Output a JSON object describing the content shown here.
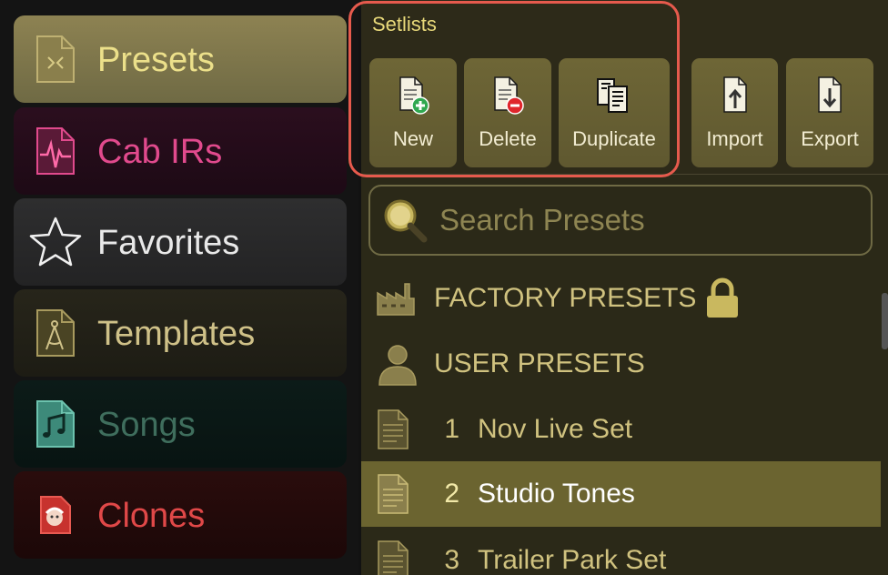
{
  "sidebar": {
    "items": [
      {
        "label": "Presets",
        "icon": "presets-file-icon"
      },
      {
        "label": "Cab IRs",
        "icon": "cab-ir-waveform-icon"
      },
      {
        "label": "Favorites",
        "icon": "star-icon"
      },
      {
        "label": "Templates",
        "icon": "template-compass-icon"
      },
      {
        "label": "Songs",
        "icon": "music-note-icon"
      },
      {
        "label": "Clones",
        "icon": "clone-sheep-icon"
      }
    ],
    "selected": "Presets"
  },
  "toolbar": {
    "section_label": "Setlists",
    "new_label": "New",
    "delete_label": "Delete",
    "duplicate_label": "Duplicate",
    "import_label": "Import",
    "export_label": "Export"
  },
  "search": {
    "placeholder": "Search Presets"
  },
  "tree": {
    "factory_label": "FACTORY PRESETS",
    "user_label": "USER PRESETS"
  },
  "setlists": [
    {
      "num": "1",
      "name": "Nov Live Set"
    },
    {
      "num": "2",
      "name": "Studio Tones"
    },
    {
      "num": "3",
      "name": "Trailer Park Set"
    }
  ],
  "selected_setlist": "Studio Tones",
  "colors": {
    "accent_gold": "#e8d97a",
    "button_bg": "#6e6636",
    "highlight_ring": "#e65a4d",
    "cab_ir_pink": "#e14a8d",
    "songs_teal": "#3f6e5d",
    "clones_red": "#e04848"
  }
}
